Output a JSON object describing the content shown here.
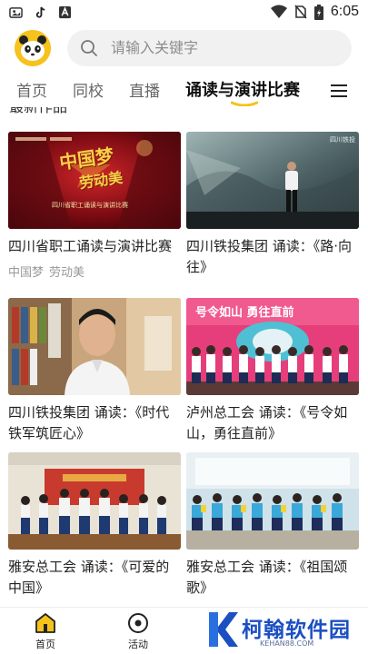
{
  "status_bar": {
    "time": "6:05",
    "left_icons": [
      "gallery-app-icon",
      "tiktok-icon",
      "a-app-icon"
    ],
    "right_icons": [
      "wifi-icon",
      "no-sim-icon",
      "battery-icon"
    ]
  },
  "header": {
    "logo_icon": "panda-logo-icon",
    "search_placeholder": "请输入关键字"
  },
  "tabs": [
    {
      "label": "首页",
      "active": false
    },
    {
      "label": "同校",
      "active": false
    },
    {
      "label": "直播",
      "active": false
    },
    {
      "label": "诵读与演讲比赛",
      "active": true
    }
  ],
  "menu_icon": "hamburger-menu-icon",
  "accent_color": "#f6c21c",
  "section_title_partial": "最新作品",
  "cards": [
    {
      "title": "四川省职工诵读与演讲比赛",
      "tags": [
        "中国梦",
        "劳动美"
      ]
    },
    {
      "title": "四川铁投集团 诵读：《路·向往》",
      "tags": []
    },
    {
      "title": "四川铁投集团 诵读：《时代铁军筑匠心》",
      "tags": []
    },
    {
      "title": "泸州总工会 诵读：《号令如山，勇往直前》",
      "tags": []
    },
    {
      "title": "雅安总工会 诵读：《可爱的中国》",
      "tags": []
    },
    {
      "title": "雅安总工会 诵读：《祖国颂歌》",
      "tags": []
    }
  ],
  "thumb_texts": {
    "t1_big": "中国梦",
    "t1_sub": "劳动美",
    "t1_line": "四川省职工诵读与演讲比赛",
    "t2_brand": "四川铁投",
    "t4_banner": "号令如山  勇往直前"
  },
  "bottom_nav": [
    {
      "label": "首页",
      "icon": "home-icon",
      "active": true
    },
    {
      "label": "活动",
      "icon": "activity-icon",
      "active": false
    }
  ],
  "watermark": {
    "text": "柯翰软件园",
    "sub": "KEHAN88.COM",
    "icon": "k-logo-icon"
  }
}
